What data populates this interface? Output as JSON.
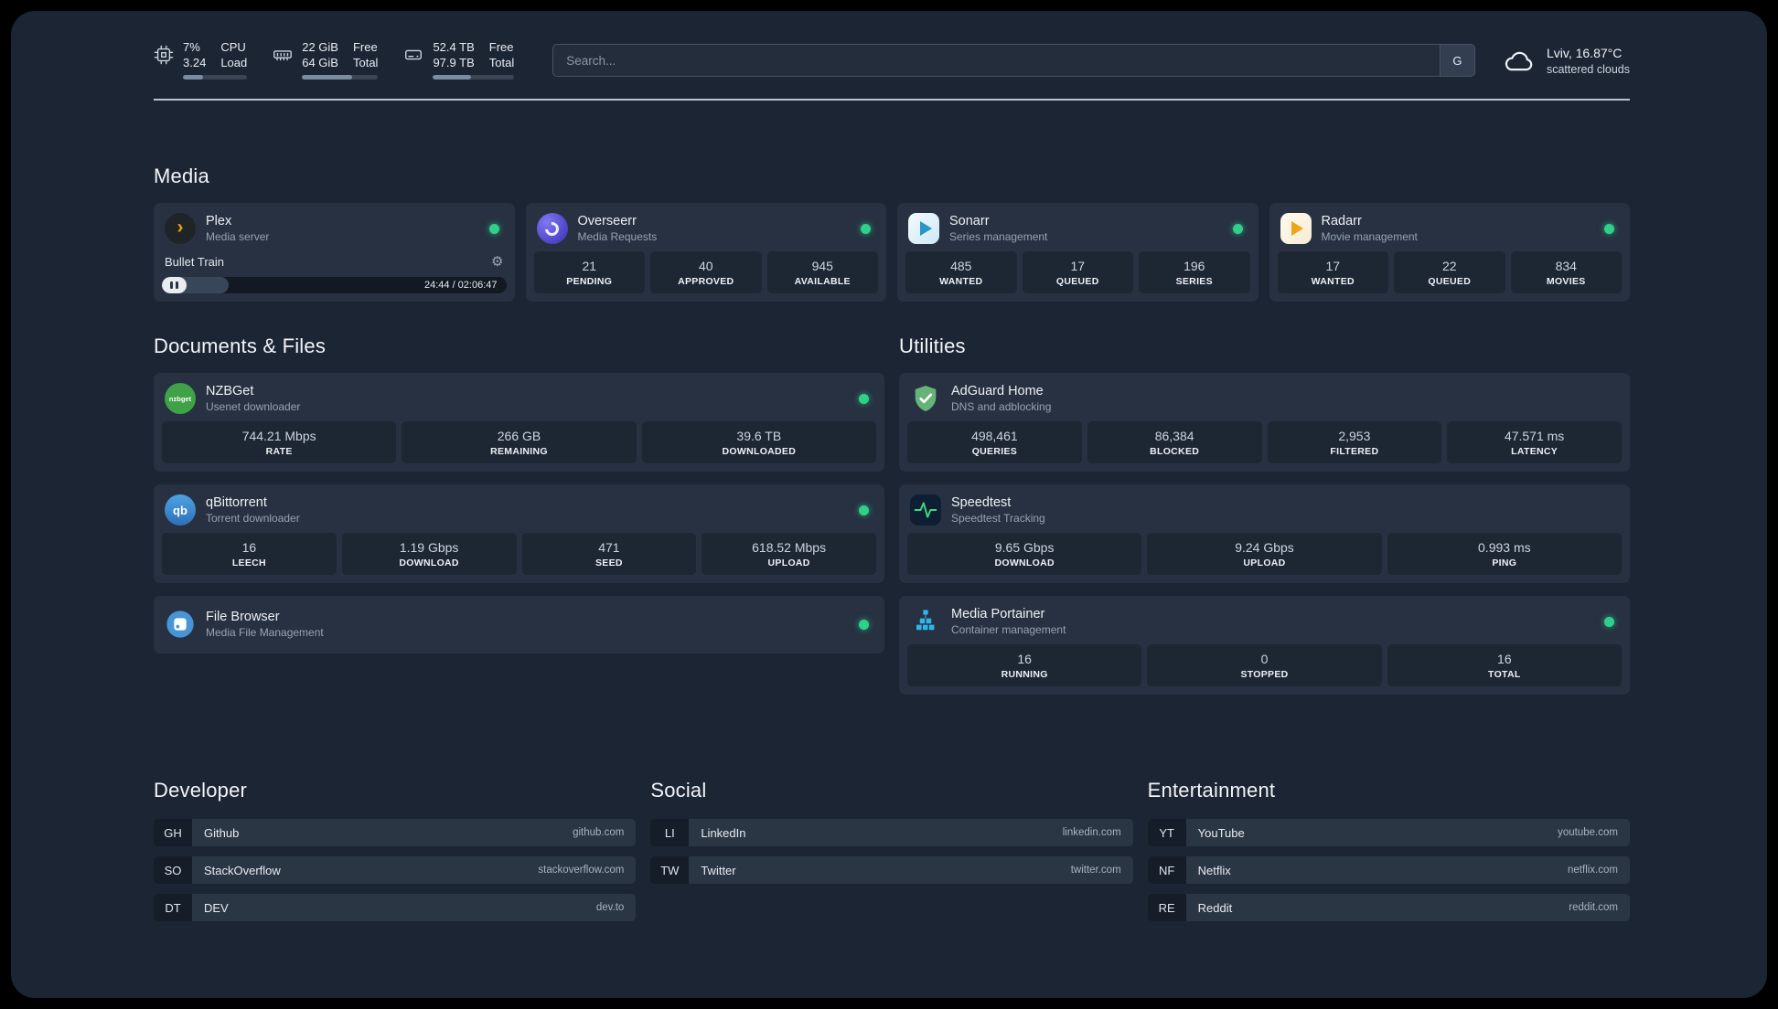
{
  "topbar": {
    "resources": [
      {
        "rows": [
          {
            "value": "7%",
            "label": "CPU"
          },
          {
            "value": "3.24",
            "label": "Load"
          }
        ],
        "progress": "32%"
      },
      {
        "rows": [
          {
            "value": "22 GiB",
            "label": "Free"
          },
          {
            "value": "64 GiB",
            "label": "Total"
          }
        ],
        "progress": "66%"
      },
      {
        "rows": [
          {
            "value": "52.4 TB",
            "label": "Free"
          },
          {
            "value": "97.9 TB",
            "label": "Total"
          }
        ],
        "progress": "47%"
      }
    ],
    "search": {
      "placeholder": "Search...",
      "provider": "G"
    },
    "weather": {
      "location": "Lviv, 16.87°C",
      "condition": "scattered clouds"
    }
  },
  "sections": {
    "media": {
      "title": "Media"
    },
    "documents": {
      "title": "Documents & Files"
    },
    "utilities": {
      "title": "Utilities"
    }
  },
  "media": {
    "cards": [
      {
        "title": "Plex",
        "subtitle": "Media server",
        "player": {
          "track": "Bullet Train",
          "time": "24:44 / 02:06:47",
          "progress": "19.5%"
        }
      },
      {
        "title": "Overseerr",
        "subtitle": "Media Requests",
        "stats": [
          {
            "value": "21",
            "label": "PENDING"
          },
          {
            "value": "40",
            "label": "APPROVED"
          },
          {
            "value": "945",
            "label": "AVAILABLE"
          }
        ]
      },
      {
        "title": "Sonarr",
        "subtitle": "Series management",
        "stats": [
          {
            "value": "485",
            "label": "WANTED"
          },
          {
            "value": "17",
            "label": "QUEUED"
          },
          {
            "value": "196",
            "label": "SERIES"
          }
        ]
      },
      {
        "title": "Radarr",
        "subtitle": "Movie management",
        "stats": [
          {
            "value": "17",
            "label": "WANTED"
          },
          {
            "value": "22",
            "label": "QUEUED"
          },
          {
            "value": "834",
            "label": "MOVIES"
          }
        ]
      }
    ]
  },
  "documents": {
    "cards": [
      {
        "title": "NZBGet",
        "subtitle": "Usenet downloader",
        "stats": [
          {
            "value": "744.21 Mbps",
            "label": "RATE"
          },
          {
            "value": "266 GB",
            "label": "REMAINING"
          },
          {
            "value": "39.6 TB",
            "label": "DOWNLOADED"
          }
        ]
      },
      {
        "title": "qBittorrent",
        "subtitle": "Torrent downloader",
        "stats": [
          {
            "value": "16",
            "label": "LEECH"
          },
          {
            "value": "1.19 Gbps",
            "label": "DOWNLOAD"
          },
          {
            "value": "471",
            "label": "SEED"
          },
          {
            "value": "618.52 Mbps",
            "label": "UPLOAD"
          }
        ]
      },
      {
        "title": "File Browser",
        "subtitle": "Media File Management"
      }
    ]
  },
  "utilities": {
    "cards": [
      {
        "title": "AdGuard Home",
        "subtitle": "DNS and adblocking",
        "stats": [
          {
            "value": "498,461",
            "label": "QUERIES"
          },
          {
            "value": "86,384",
            "label": "BLOCKED"
          },
          {
            "value": "2,953",
            "label": "FILTERED"
          },
          {
            "value": "47.571 ms",
            "label": "LATENCY"
          }
        ]
      },
      {
        "title": "Speedtest",
        "subtitle": "Speedtest Tracking",
        "stats": [
          {
            "value": "9.65 Gbps",
            "label": "DOWNLOAD"
          },
          {
            "value": "9.24 Gbps",
            "label": "UPLOAD"
          },
          {
            "value": "0.993 ms",
            "label": "PING"
          }
        ]
      },
      {
        "title": "Media Portainer",
        "subtitle": "Container management",
        "stats": [
          {
            "value": "16",
            "label": "RUNNING"
          },
          {
            "value": "0",
            "label": "STOPPED"
          },
          {
            "value": "16",
            "label": "TOTAL"
          }
        ]
      }
    ]
  },
  "bookmarks": {
    "groups": [
      {
        "title": "Developer",
        "items": [
          {
            "abbr": "GH",
            "name": "Github",
            "domain": "github.com"
          },
          {
            "abbr": "SO",
            "name": "StackOverflow",
            "domain": "stackoverflow.com"
          },
          {
            "abbr": "DT",
            "name": "DEV",
            "domain": "dev.to"
          }
        ]
      },
      {
        "title": "Social",
        "items": [
          {
            "abbr": "LI",
            "name": "LinkedIn",
            "domain": "linkedin.com"
          },
          {
            "abbr": "TW",
            "name": "Twitter",
            "domain": "twitter.com"
          }
        ]
      },
      {
        "title": "Entertainment",
        "items": [
          {
            "abbr": "YT",
            "name": "YouTube",
            "domain": "youtube.com"
          },
          {
            "abbr": "NF",
            "name": "Netflix",
            "domain": "netflix.com"
          },
          {
            "abbr": "RE",
            "name": "Reddit",
            "domain": "reddit.com"
          }
        ]
      }
    ]
  },
  "icons": {
    "plex": "›",
    "gear": "⚙",
    "nzbget": "nzbget",
    "qbittorrent": "qb"
  },
  "colors": {
    "background": "#1c2534",
    "card": "#273141",
    "stat_block": "#1d2633",
    "status_online": "#2fd08c",
    "plex_gold": "#e5a00d",
    "sonarr_blue": "#2796c8",
    "radarr_gold": "#efa41c"
  }
}
